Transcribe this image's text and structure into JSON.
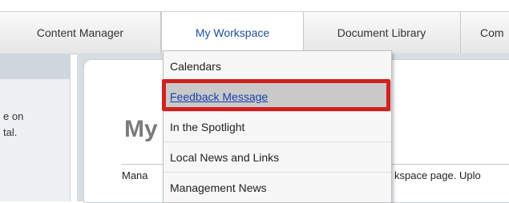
{
  "nav": {
    "tabs": [
      {
        "label": "Content Manager"
      },
      {
        "label": "My Workspace"
      },
      {
        "label": "Document Library"
      },
      {
        "label": "Com"
      }
    ]
  },
  "left_panel": {
    "line1": "e on",
    "line2": "tal."
  },
  "main": {
    "title": "My",
    "description_left": "Mana",
    "description_right": "kspace page. Uplo"
  },
  "dropdown": {
    "items": [
      {
        "label": "Calendars"
      },
      {
        "label": "Feedback Message"
      },
      {
        "label": "In the Spotlight"
      },
      {
        "label": "Local News and Links"
      },
      {
        "label": "Management News"
      }
    ],
    "selected_index": 1,
    "highlight_color": "#d21f1f"
  }
}
